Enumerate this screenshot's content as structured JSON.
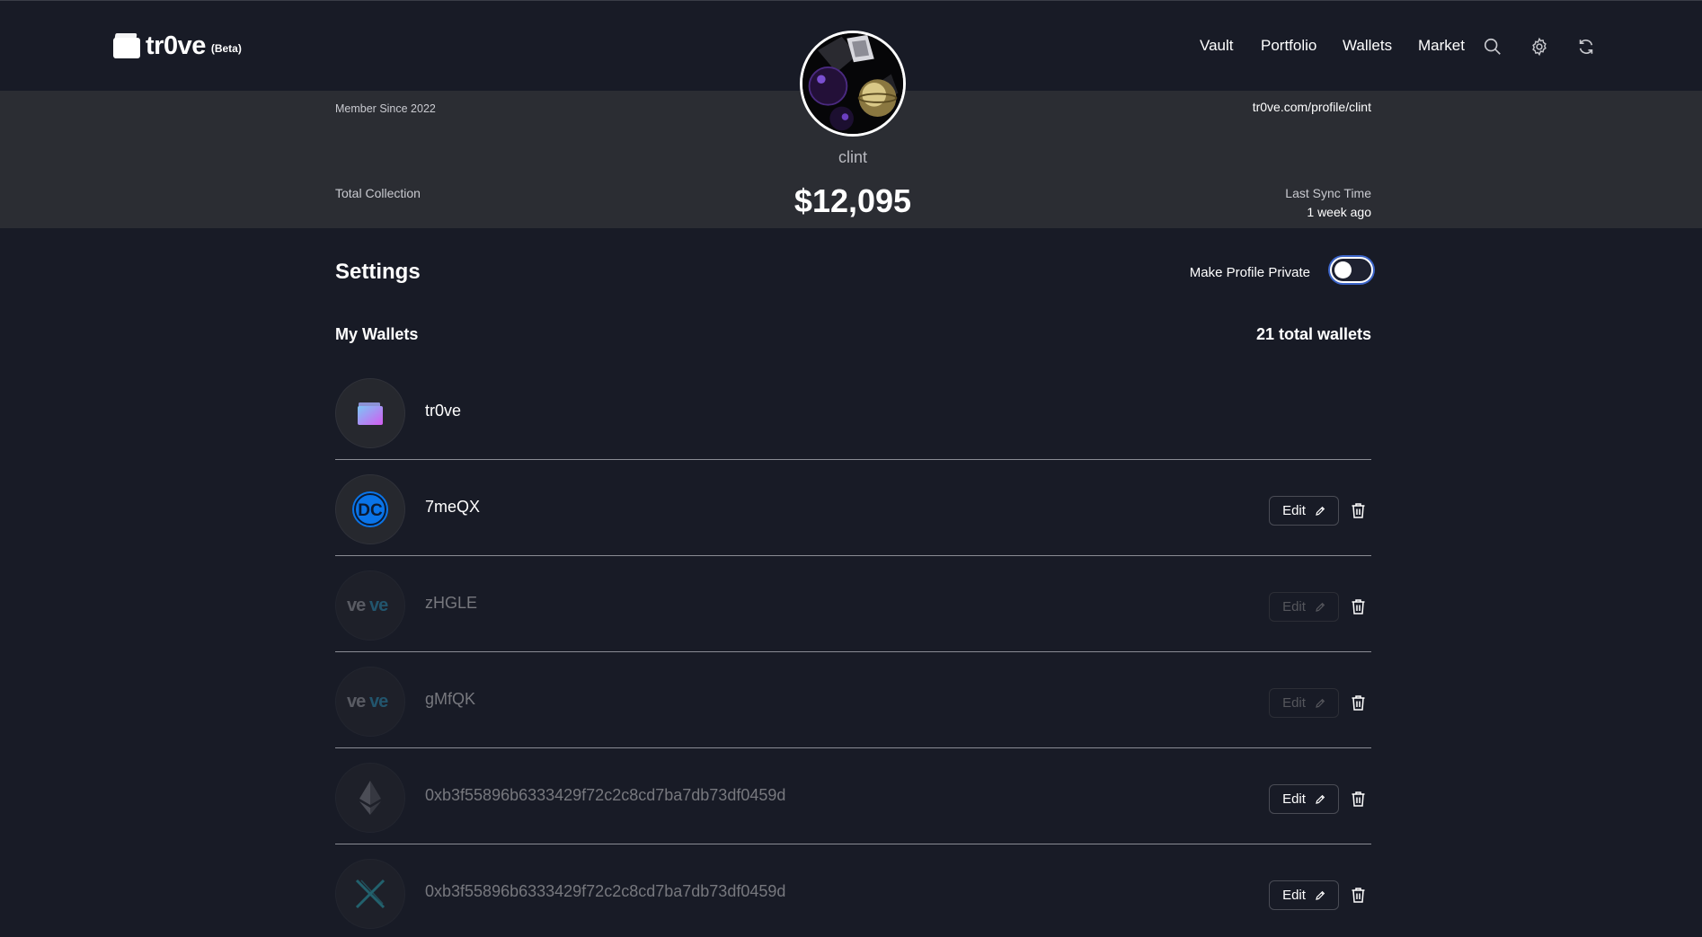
{
  "header": {
    "logo_text": "tr0ve",
    "logo_badge": "(Beta)",
    "nav": [
      "Vault",
      "Portfolio",
      "Wallets",
      "Market"
    ],
    "icons": [
      "search-icon",
      "gear-icon",
      "refresh-icon"
    ]
  },
  "profile": {
    "member_since": "Member Since 2022",
    "url": "tr0ve.com/profile/clint",
    "username": "clint",
    "total_label": "Total Collection",
    "total_value": "$12,095",
    "sync_label": "Last Sync Time",
    "sync_value": "1 week ago"
  },
  "settings": {
    "title": "Settings",
    "private_label": "Make Profile Private",
    "private_enabled": false,
    "wallets_title": "My Wallets",
    "wallets_count": "21 total wallets"
  },
  "wallets": [
    {
      "name": "tr0ve",
      "icon": "trove-wallet-icon",
      "dim": false,
      "editable": false
    },
    {
      "name": "7meQX",
      "icon": "dc-logo-icon",
      "dim": false,
      "editable": true,
      "edit_label": "Edit"
    },
    {
      "name": "zHGLE",
      "icon": "veve-logo-icon",
      "dim": true,
      "editable": true,
      "edit_label": "Edit",
      "edit_dim": true
    },
    {
      "name": "gMfQK",
      "icon": "veve-logo-icon",
      "dim": true,
      "editable": true,
      "edit_label": "Edit",
      "edit_dim": true
    },
    {
      "name": "0xb3f55896b6333429f72c2c8cd7ba7db73df0459d",
      "icon": "ethereum-icon",
      "dim": true,
      "editable": true,
      "edit_label": "Edit",
      "edit_dim": false
    },
    {
      "name": "0xb3f55896b6333429f72c2c8cd7ba7db73df0459d",
      "icon": "immutable-x-icon",
      "dim": true,
      "editable": true,
      "edit_label": "Edit",
      "edit_dim": false
    }
  ],
  "colors": {
    "background": "#181b26",
    "banner": "#2b2d33",
    "accent": "#3b64c8",
    "dc_blue": "#0a74e8"
  }
}
